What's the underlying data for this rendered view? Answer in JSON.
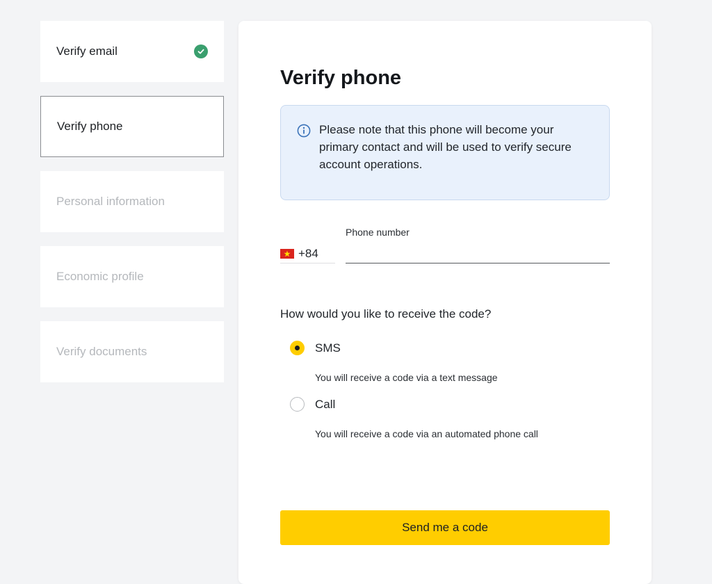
{
  "steps": [
    {
      "label": "Verify email",
      "status": "done"
    },
    {
      "label": "Verify phone",
      "status": "active"
    },
    {
      "label": "Personal information",
      "status": "pending"
    },
    {
      "label": "Economic profile",
      "status": "pending"
    },
    {
      "label": "Verify documents",
      "status": "pending"
    }
  ],
  "card": {
    "title": "Verify phone",
    "notice": "Please note that this phone will become your primary contact and will be used to verify secure account operations.",
    "phone": {
      "label": "Phone number",
      "country_code": "+84",
      "country_flag": "vietnam-flag-icon",
      "value": ""
    },
    "question": "How would you like to receive the code?",
    "options": [
      {
        "label": "SMS",
        "description": "You will receive a code via a text message",
        "selected": true
      },
      {
        "label": "Call",
        "description": "You will receive a code via an automated phone call",
        "selected": false
      }
    ],
    "send_button": "Send me a code"
  },
  "colors": {
    "accent": "#ffcd00",
    "success": "#3a9f6e",
    "notice_bg": "#e9f1fc",
    "info_icon": "#3b73b9"
  }
}
